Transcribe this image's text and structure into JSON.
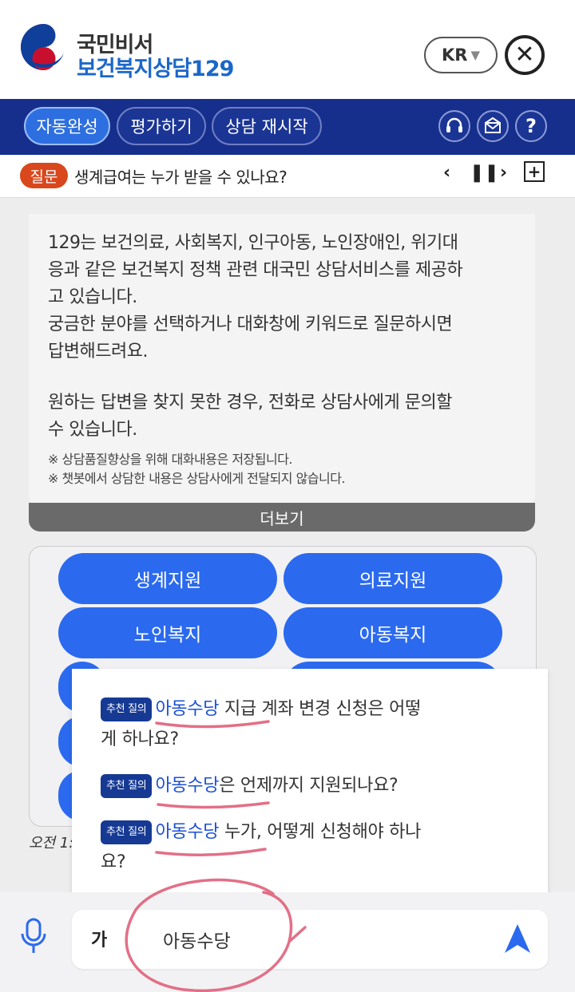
{
  "header": {
    "brand_top": "국민비서",
    "brand_bottom": "보건복지상담129",
    "lang": "KR"
  },
  "toolbar": {
    "autocomplete": "자동완성",
    "rate": "평가하기",
    "restart": "상담 재시작"
  },
  "question_bar": {
    "tag": "질문",
    "text": "생계급여는 누가 받을 수 있나요?"
  },
  "card": {
    "lines": [
      "129는 보건의료, 사회복지, 인구아동, 노인장애인, 위기대",
      "응과 같은 보건복지 정책 관련 대국민 상담서비스를 제공하",
      "고 있습니다.",
      "궁금한 분야를 선택하거나 대화창에 키워드로 질문하시면",
      "답변해드려요.",
      "원하는 답변을 찾지 못한 경우, 전화로 상담사에게 문의할",
      "수 있습니다."
    ],
    "notes": [
      "※ 상담품질향상을 위해 대화내용은 저장됩니다.",
      "※ 챗봇에서 상담한 내용은 상담사에게 전달되지 않습니다."
    ],
    "more": "더보기"
  },
  "categories": [
    "생계지원",
    "의료지원",
    "노인복지",
    "아동복지"
  ],
  "timestamp": "오전 1:",
  "suggestions": {
    "tag": "추천 질의",
    "items": [
      {
        "keyword": "아동수당",
        "rest_1": " 지급 계좌 변경 신청은 어떻",
        "rest_2": "게 하나요?"
      },
      {
        "keyword": "아동수당",
        "rest_1": "은 언제까지 지원되나요?",
        "rest_2": ""
      },
      {
        "keyword": "아동수당",
        "rest_1": " 누가, 어떻게 신청해야 하나",
        "rest_2": "요?"
      }
    ]
  },
  "input": {
    "font_toggle": "가",
    "value": "아동수당"
  },
  "colors": {
    "navy": "#162f8c",
    "accent_blue": "#2b6aee",
    "question_tag": "#d9471c",
    "annotation_pink": "#e0607a"
  }
}
